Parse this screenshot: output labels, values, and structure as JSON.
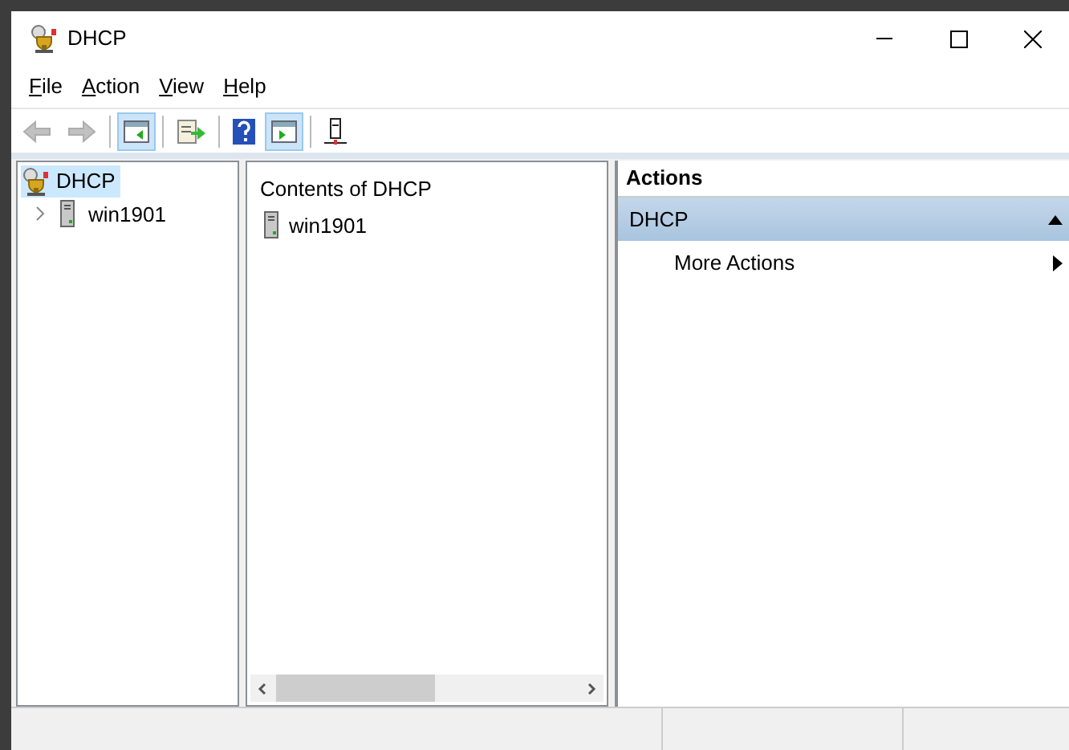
{
  "window": {
    "title": "DHCP"
  },
  "menu": [
    {
      "label": "File"
    },
    {
      "label": "Action"
    },
    {
      "label": "View"
    },
    {
      "label": "Help"
    }
  ],
  "toolbar": [
    {
      "kind": "back",
      "disabled": true
    },
    {
      "kind": "forward",
      "disabled": true
    },
    {
      "kind": "sep"
    },
    {
      "kind": "tree-pane",
      "selected": true
    },
    {
      "kind": "sep"
    },
    {
      "kind": "export",
      "selected": false
    },
    {
      "kind": "sep"
    },
    {
      "kind": "help",
      "selected": false
    },
    {
      "kind": "action-pane",
      "selected": true
    },
    {
      "kind": "sep"
    },
    {
      "kind": "server",
      "selected": false
    }
  ],
  "tree": {
    "label": "DHCP",
    "selected": true,
    "children": [
      {
        "label": "win1901",
        "expanded": false,
        "selected": false
      }
    ]
  },
  "contents": {
    "title": "Contents of DHCP",
    "items": [
      {
        "label": "win1901"
      }
    ]
  },
  "actions": {
    "title": "Actions",
    "sections": [
      {
        "label": "DHCP",
        "expanded": true,
        "items": [
          {
            "label": "More Actions",
            "submenu": true
          }
        ]
      }
    ]
  }
}
